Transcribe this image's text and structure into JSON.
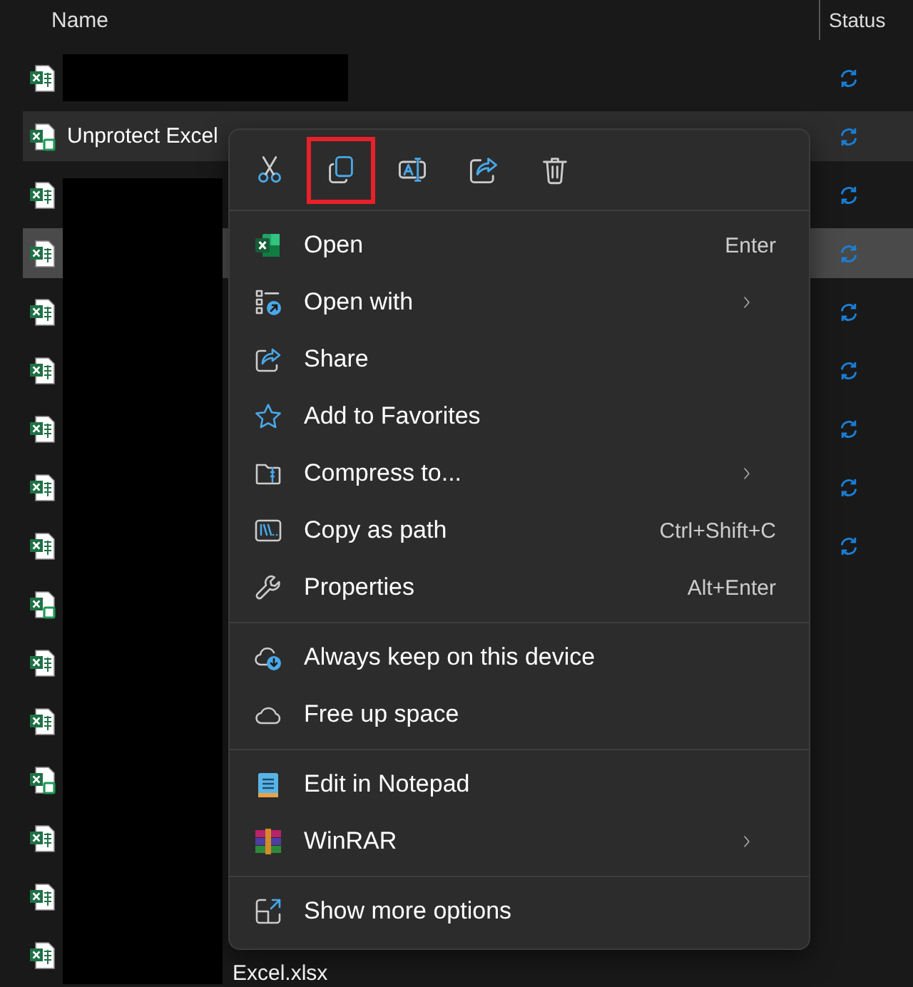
{
  "columns": [
    {
      "label": "Name"
    },
    {
      "label": "Status"
    }
  ],
  "files": [
    {
      "kind": "sheet",
      "redacted": true,
      "covered": false,
      "syncing": true,
      "hovered": false,
      "selected": false
    },
    {
      "kind": "badged",
      "name": "Unprotect Excel",
      "covered": false,
      "syncing": true,
      "hovered": true,
      "selected": false
    },
    {
      "kind": "sheet",
      "covered": true,
      "syncing": true,
      "hovered": false,
      "selected": false
    },
    {
      "kind": "sheet",
      "covered": true,
      "syncing": true,
      "hovered": false,
      "selected": true
    },
    {
      "kind": "sheet",
      "covered": true,
      "syncing": true,
      "hovered": false,
      "selected": false
    },
    {
      "kind": "sheet",
      "covered": true,
      "syncing": true,
      "hovered": false,
      "selected": false
    },
    {
      "kind": "sheet",
      "covered": true,
      "syncing": true,
      "hovered": false,
      "selected": false
    },
    {
      "kind": "sheet",
      "covered": true,
      "syncing": true,
      "hovered": false,
      "selected": false
    },
    {
      "kind": "sheet",
      "covered": true,
      "syncing": true,
      "hovered": false,
      "selected": false
    },
    {
      "kind": "badged",
      "covered": true,
      "syncing": false,
      "hovered": false,
      "selected": false
    },
    {
      "kind": "sheet",
      "covered": true,
      "syncing": false,
      "hovered": false,
      "selected": false
    },
    {
      "kind": "sheet",
      "covered": true,
      "syncing": false,
      "hovered": false,
      "selected": false
    },
    {
      "kind": "badged",
      "covered": true,
      "syncing": false,
      "hovered": false,
      "selected": false
    },
    {
      "kind": "sheet",
      "covered": true,
      "syncing": false,
      "hovered": false,
      "selected": false
    },
    {
      "kind": "sheet",
      "covered": true,
      "syncing": false,
      "hovered": false,
      "selected": false
    },
    {
      "kind": "sheet",
      "name": "Excel.xlsx",
      "covered": true,
      "syncing": false,
      "hovered": false,
      "selected": false
    }
  ],
  "context_menu": {
    "toolbar": [
      {
        "kind": "cut",
        "highlighted": false
      },
      {
        "kind": "copy",
        "highlighted": true
      },
      {
        "kind": "rename",
        "highlighted": false
      },
      {
        "kind": "share",
        "highlighted": false
      },
      {
        "kind": "delete",
        "highlighted": false
      }
    ],
    "groups": [
      [
        {
          "kind": "excel",
          "label": "Open",
          "shortcut": "Enter",
          "submenu": false
        },
        {
          "kind": "apps",
          "label": "Open with",
          "submenu": true
        },
        {
          "kind": "share",
          "label": "Share",
          "submenu": false
        },
        {
          "kind": "star",
          "label": "Add to Favorites",
          "submenu": false
        },
        {
          "kind": "zip",
          "label": "Compress to...",
          "submenu": true
        },
        {
          "kind": "path",
          "label": "Copy as path",
          "shortcut": "Ctrl+Shift+C",
          "submenu": false
        },
        {
          "kind": "wrench",
          "label": "Properties",
          "shortcut": "Alt+Enter",
          "submenu": false
        }
      ],
      [
        {
          "kind": "pin",
          "label": "Always keep on this device",
          "submenu": false
        },
        {
          "kind": "cloud",
          "label": "Free up space",
          "submenu": false
        }
      ],
      [
        {
          "kind": "notepad",
          "label": "Edit in Notepad",
          "submenu": false
        },
        {
          "kind": "winrar",
          "label": "WinRAR",
          "submenu": true
        }
      ],
      [
        {
          "kind": "more",
          "label": "Show more options",
          "submenu": false
        }
      ]
    ]
  }
}
